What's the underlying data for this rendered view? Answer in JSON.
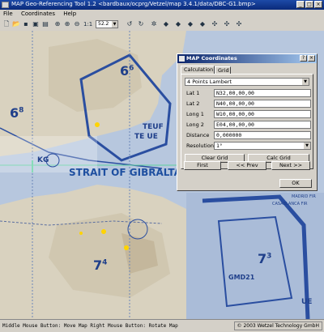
{
  "window": {
    "title": "MAP Geo-Referencing Tool 1.2 <bardbaux/ocprg/Vetzel/map 3.4.1/data/DBC-G1.bmp>",
    "controls": [
      "_",
      "□",
      "×"
    ]
  },
  "menu": [
    "File",
    "Coordinates",
    "Help"
  ],
  "toolbar": {
    "zoom_value": "52.2"
  },
  "map": {
    "labels": {
      "sector1": "6",
      "sector1_sup": "6",
      "sector2": "6",
      "sector2_sup": "8",
      "strait": "STRAIT OF GIBRALTA",
      "sector3": "7",
      "sector3_sup": "4",
      "sector4": "7",
      "sector4_sup": "3",
      "gmd": "GMD21",
      "kg": "KG",
      "teuf": "TEUF",
      "ue": "UE",
      "te_ue": "TE UE",
      "madrid": "MADRID FIR",
      "casablanca": "CASABLANCA FIR"
    },
    "colors": {
      "sea": "#b7c7de",
      "land": "#d9d2bf",
      "blue_line": "#2a4ea0",
      "grid": "#5fd0a0"
    }
  },
  "dialog": {
    "title": "MAP Coordinates",
    "tabs": [
      "Calculation",
      "Grid"
    ],
    "method": "4 Points Lambert",
    "fields": [
      {
        "label": "Lat 1",
        "value": "N32,00,00,00"
      },
      {
        "label": "Lat 2",
        "value": "N40,00,00,00"
      },
      {
        "label": "Long 1",
        "value": "W10,00,00,00"
      },
      {
        "label": "Long 2",
        "value": "E04,00,00,00"
      },
      {
        "label": "Distance",
        "value": "0,000000"
      }
    ],
    "resolution_label": "Resolution",
    "resolution_value": "1°",
    "buttons": {
      "clear_grid": "Clear Grid",
      "calc_grid": "Calc Grid",
      "first": "First",
      "prev": "<< Prev",
      "next": "Next >>",
      "ok": "OK"
    }
  },
  "status": {
    "hint": "Middle Mouse Button: Move Map  Right Mouse Button: Rotate Map",
    "copyright": "© 2003 Wetzel Technology GmbH"
  }
}
